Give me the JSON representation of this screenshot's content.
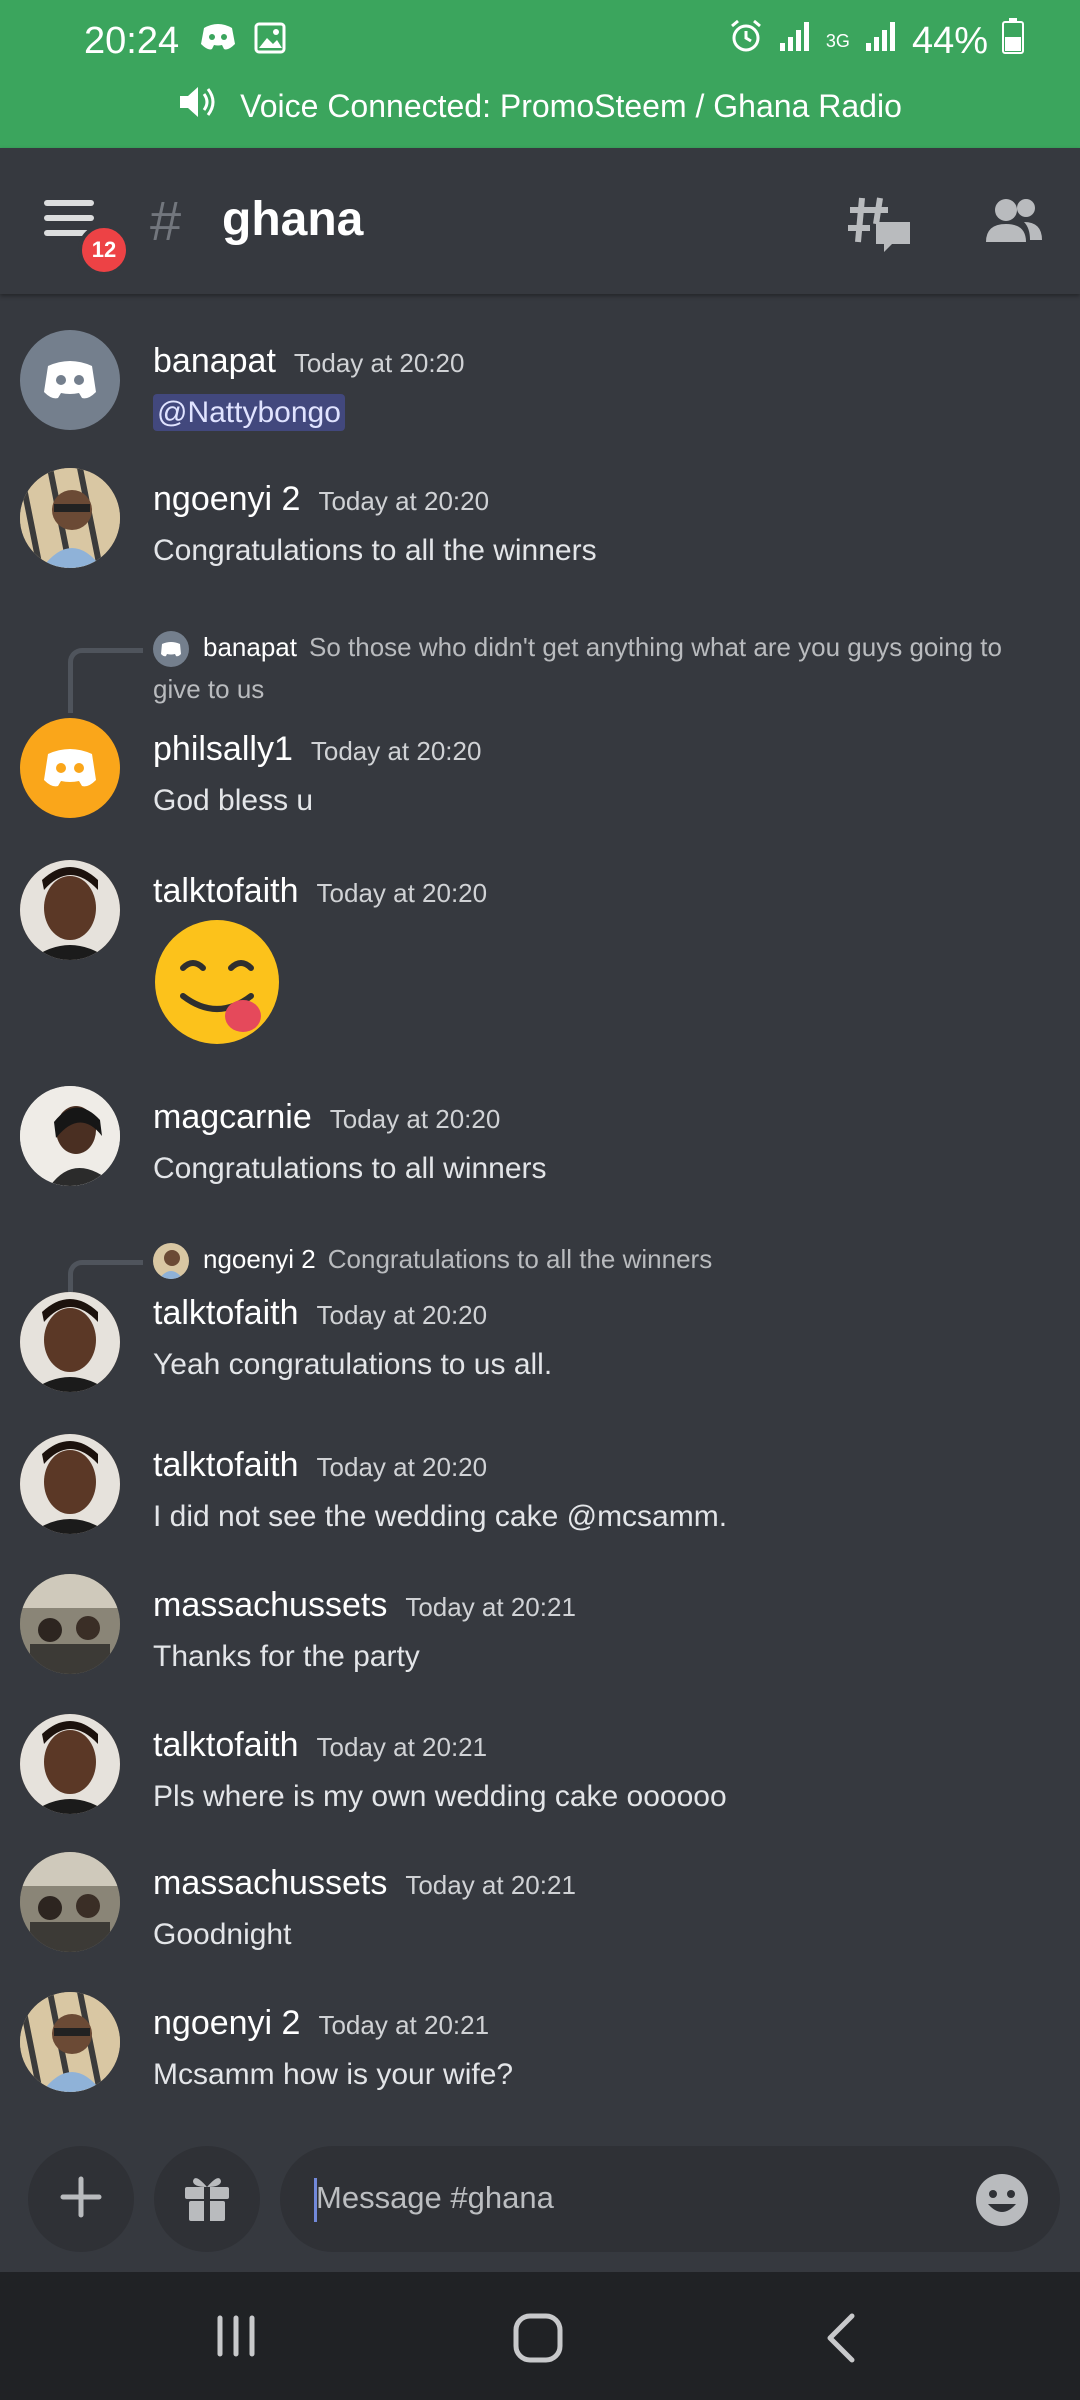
{
  "status": {
    "time": "20:24",
    "network_label": "3G",
    "battery": "44%"
  },
  "voice": {
    "text": "Voice Connected: PromoSteem / Ghana Radio"
  },
  "header": {
    "badge": "12",
    "hash": "#",
    "channel": "ghana"
  },
  "messages": [
    {
      "user": "banapat",
      "time": "Today at 20:20",
      "text": "@Nattybongo"
    },
    {
      "user": "ngoenyi 2",
      "time": "Today at 20:20",
      "text": "Congratulations to all the winners"
    },
    {
      "reply_user": "banapat",
      "reply_text": "So those who didn't get anything what are you guys going to give to us",
      "user": "philsally1",
      "time": "Today at 20:20",
      "text": "God bless u"
    },
    {
      "user": "talktofaith",
      "time": "Today at 20:20",
      "emoji": "face-savoring-food-emoji"
    },
    {
      "user": "magcarnie",
      "time": "Today at 20:20",
      "text": "Congratulations to all winners"
    },
    {
      "reply_user": "ngoenyi 2",
      "reply_text": "Congratulations to all the winners",
      "user": "talktofaith",
      "time": "Today at 20:20",
      "text": "Yeah congratulations to us all."
    },
    {
      "user": "talktofaith",
      "time": "Today at 20:20",
      "text": "I did not see the wedding cake @mcsamm."
    },
    {
      "user": "massachussets",
      "time": "Today at 20:21",
      "text": "Thanks for the party"
    },
    {
      "user": "talktofaith",
      "time": "Today at 20:21",
      "text": "Pls where is my own wedding cake oooooo"
    },
    {
      "user": "massachussets",
      "time": "Today at 20:21",
      "text": "Goodnight"
    },
    {
      "user": "ngoenyi 2",
      "time": "Today at 20:21",
      "text": "Mcsamm how is your wife?"
    }
  ],
  "composer": {
    "placeholder": "Message #ghana"
  },
  "colors": {
    "voice_bar": "#3ba55d",
    "background": "#36393f",
    "badge": "#ed4245",
    "discord_gray": "#747f8d",
    "discord_orange": "#faa61a"
  }
}
